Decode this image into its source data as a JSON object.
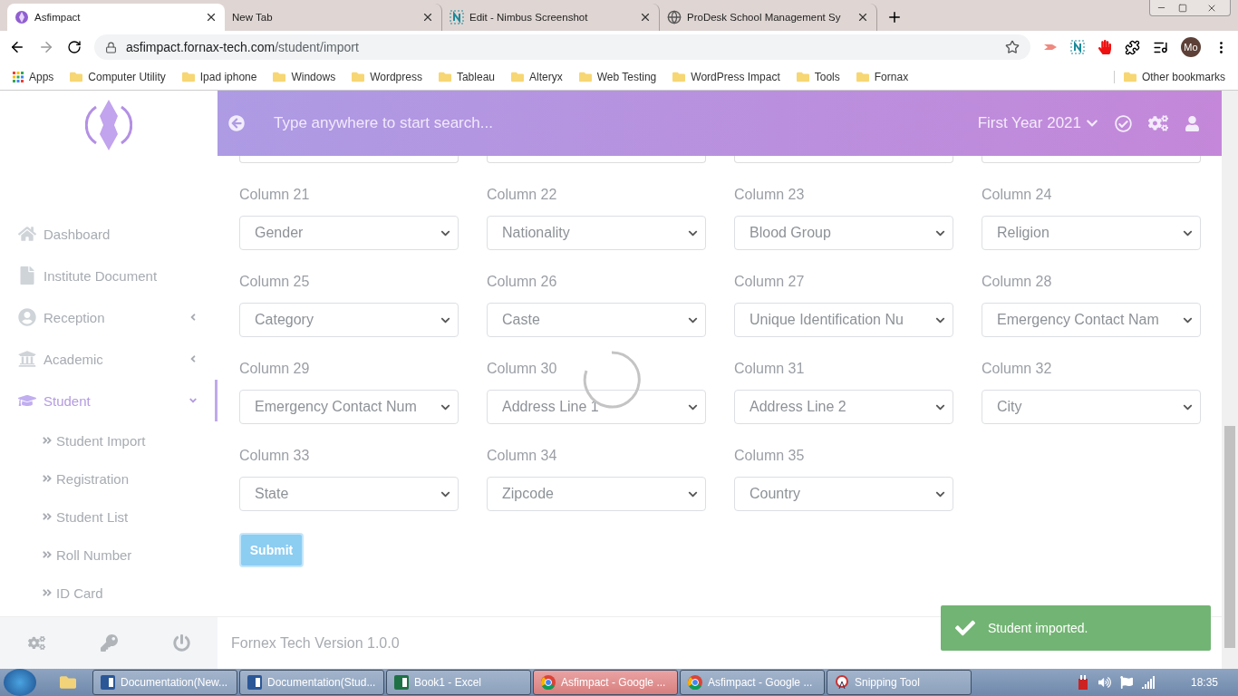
{
  "browser": {
    "tabs": [
      {
        "title": "Asfimpact",
        "kind": "app",
        "selected": true
      },
      {
        "title": "New Tab",
        "kind": "none",
        "selected": false
      },
      {
        "title": "Edit - Nimbus Screenshot",
        "kind": "nimbus",
        "selected": false
      },
      {
        "title": "ProDesk School Management Sy",
        "kind": "globe",
        "selected": false
      }
    ],
    "url_host": "asfimpact.fornax-tech.com",
    "url_path": "/student/import",
    "profile": "Mo",
    "bookmarks": [
      "Apps",
      "Computer Utility",
      "Ipad iphone",
      "Windows",
      "Wordpress",
      "Tableau",
      "Alteryx",
      "Web Testing",
      "WordPress Impact",
      "Tools",
      "Fornax"
    ],
    "other_bookmarks": "Other bookmarks"
  },
  "header": {
    "search_placeholder": "Type anywhere to start search...",
    "session": "First Year 2021"
  },
  "sidebar": {
    "items": [
      {
        "label": "Dashboard",
        "kind": "home",
        "selected": false
      },
      {
        "label": "Institute Document",
        "kind": "file",
        "selected": false
      },
      {
        "label": "Reception",
        "kind": "user",
        "selected": false,
        "expanded": false
      },
      {
        "label": "Academic",
        "kind": "building",
        "selected": false,
        "expanded": false
      },
      {
        "label": "Student",
        "kind": "cap",
        "selected": true,
        "expanded": true,
        "children": [
          {
            "label": "Student Import",
            "selected": false
          },
          {
            "label": "Registration",
            "selected": false
          },
          {
            "label": "Student List",
            "selected": false
          },
          {
            "label": "Roll Number",
            "selected": false
          },
          {
            "label": "ID Card",
            "selected": false
          }
        ]
      }
    ]
  },
  "form": {
    "columns": [
      {
        "label": "Column 21",
        "value": "Gender"
      },
      {
        "label": "Column 22",
        "value": "Nationality"
      },
      {
        "label": "Column 23",
        "value": "Blood Group"
      },
      {
        "label": "Column 24",
        "value": "Religion"
      },
      {
        "label": "Column 25",
        "value": "Category"
      },
      {
        "label": "Column 26",
        "value": "Caste"
      },
      {
        "label": "Column 27",
        "value": "Unique Identification Nu"
      },
      {
        "label": "Column 28",
        "value": "Emergency Contact Nam"
      },
      {
        "label": "Column 29",
        "value": "Emergency Contact Num"
      },
      {
        "label": "Column 30",
        "value": "Address Line 1"
      },
      {
        "label": "Column 31",
        "value": "Address Line 2"
      },
      {
        "label": "Column 32",
        "value": "City"
      },
      {
        "label": "Column 33",
        "value": "State"
      },
      {
        "label": "Column 34",
        "value": "Zipcode"
      },
      {
        "label": "Column 35",
        "value": "Country"
      }
    ],
    "submit": "Submit",
    "loading": true
  },
  "footer": "Fornex Tech Version 1.0.0",
  "toast": "Student imported.",
  "taskbar": {
    "tasks": [
      {
        "label": "Documentation(New...",
        "kind": "word",
        "selected": false
      },
      {
        "label": "Documentation(Stud...",
        "kind": "word",
        "selected": false
      },
      {
        "label": "Book1 - Excel",
        "kind": "excel",
        "selected": false
      },
      {
        "label": "Asfimpact - Google ...",
        "kind": "chrome",
        "selected": true
      },
      {
        "label": "Asfimpact - Google ...",
        "kind": "chrome",
        "selected": false
      },
      {
        "label": "Snipping Tool",
        "kind": "snip",
        "selected": false
      }
    ],
    "clock": "18:35"
  }
}
